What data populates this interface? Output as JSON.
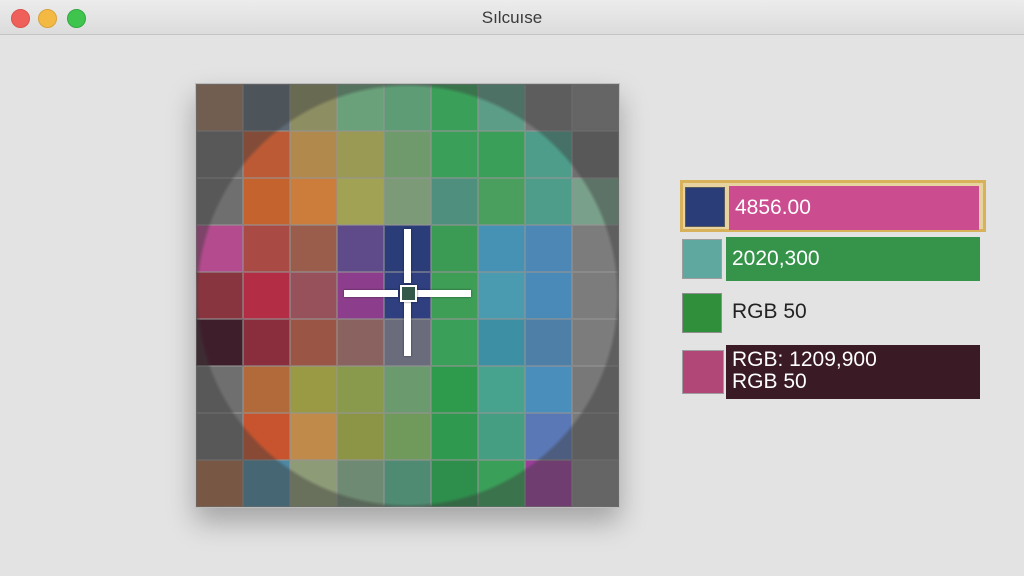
{
  "window": {
    "title": "Sılcuıse"
  },
  "magnifier": {
    "columns": 9,
    "rows": 9,
    "pixels": [
      [
        "#9f7a62",
        "#5d6973",
        "#8d8f62",
        "#6aa07a",
        "#5e9c76",
        "#3aa059",
        "#5b9d87",
        "#787878",
        "#868686"
      ],
      [
        "#6f6f6f",
        "#bc5a35",
        "#b1894c",
        "#9a9a55",
        "#6e9a6c",
        "#3aa059",
        "#3aa059",
        "#4e9c8a",
        "#6f6f6f"
      ],
      [
        "#6f6f6f",
        "#c4632e",
        "#cc7c3b",
        "#a1a253",
        "#7c9a78",
        "#4e8f7d",
        "#4a9f5e",
        "#4e9c8a",
        "#79a08a"
      ],
      [
        "#b34b8e",
        "#a94a44",
        "#9a5d4c",
        "#5f4b8a",
        "#2b3d78",
        "#3b9a54",
        "#4592b4",
        "#4c87b5",
        "#7c7c7c"
      ],
      [
        "#893540",
        "#b32d44",
        "#97515a",
        "#8c3e8c",
        "#2f3f7f",
        "#3f9e56",
        "#4a9ab0",
        "#4a8ab8",
        "#7c7c7c"
      ],
      [
        "#3f1e2c",
        "#8a2e3e",
        "#9b5544",
        "#8a6360",
        "#6a6c7c",
        "#3aa059",
        "#3d8fa4",
        "#4d7fa7",
        "#7c7c7c"
      ],
      [
        "#6f6f6f",
        "#b36a3a",
        "#9a9a44",
        "#8a9a4c",
        "#6a9a6e",
        "#2e9a4c",
        "#48a38e",
        "#4a8fbc",
        "#787878"
      ],
      [
        "#6f6f6f",
        "#c7542f",
        "#c08a4a",
        "#8c9446",
        "#6f9a5c",
        "#2f9a4f",
        "#469e82",
        "#5a78b6",
        "#7a7a7a"
      ],
      [
        "#a96f4a",
        "#4e88a2",
        "#8e9b77",
        "#6f8a72",
        "#4f8b72",
        "#2e8e4c",
        "#3aa059",
        "#9a3e9a",
        "#868686"
      ]
    ]
  },
  "colors": [
    {
      "label": "4856.00",
      "swatch": "#2b3d78",
      "bar": "#cb4d8f",
      "selected": true
    },
    {
      "label": "2020,300",
      "swatch": "#5fa8a0",
      "bar": "#35944a",
      "selected": false
    },
    {
      "label": "RGB 50",
      "swatch": "#2f8f3a",
      "bar": null,
      "selected": false
    },
    {
      "label_line1": "RGB: 1209,900",
      "label_line2": "RGB 50",
      "swatch": "#b04777",
      "bar": "#3a1a25",
      "selected": false
    }
  ]
}
